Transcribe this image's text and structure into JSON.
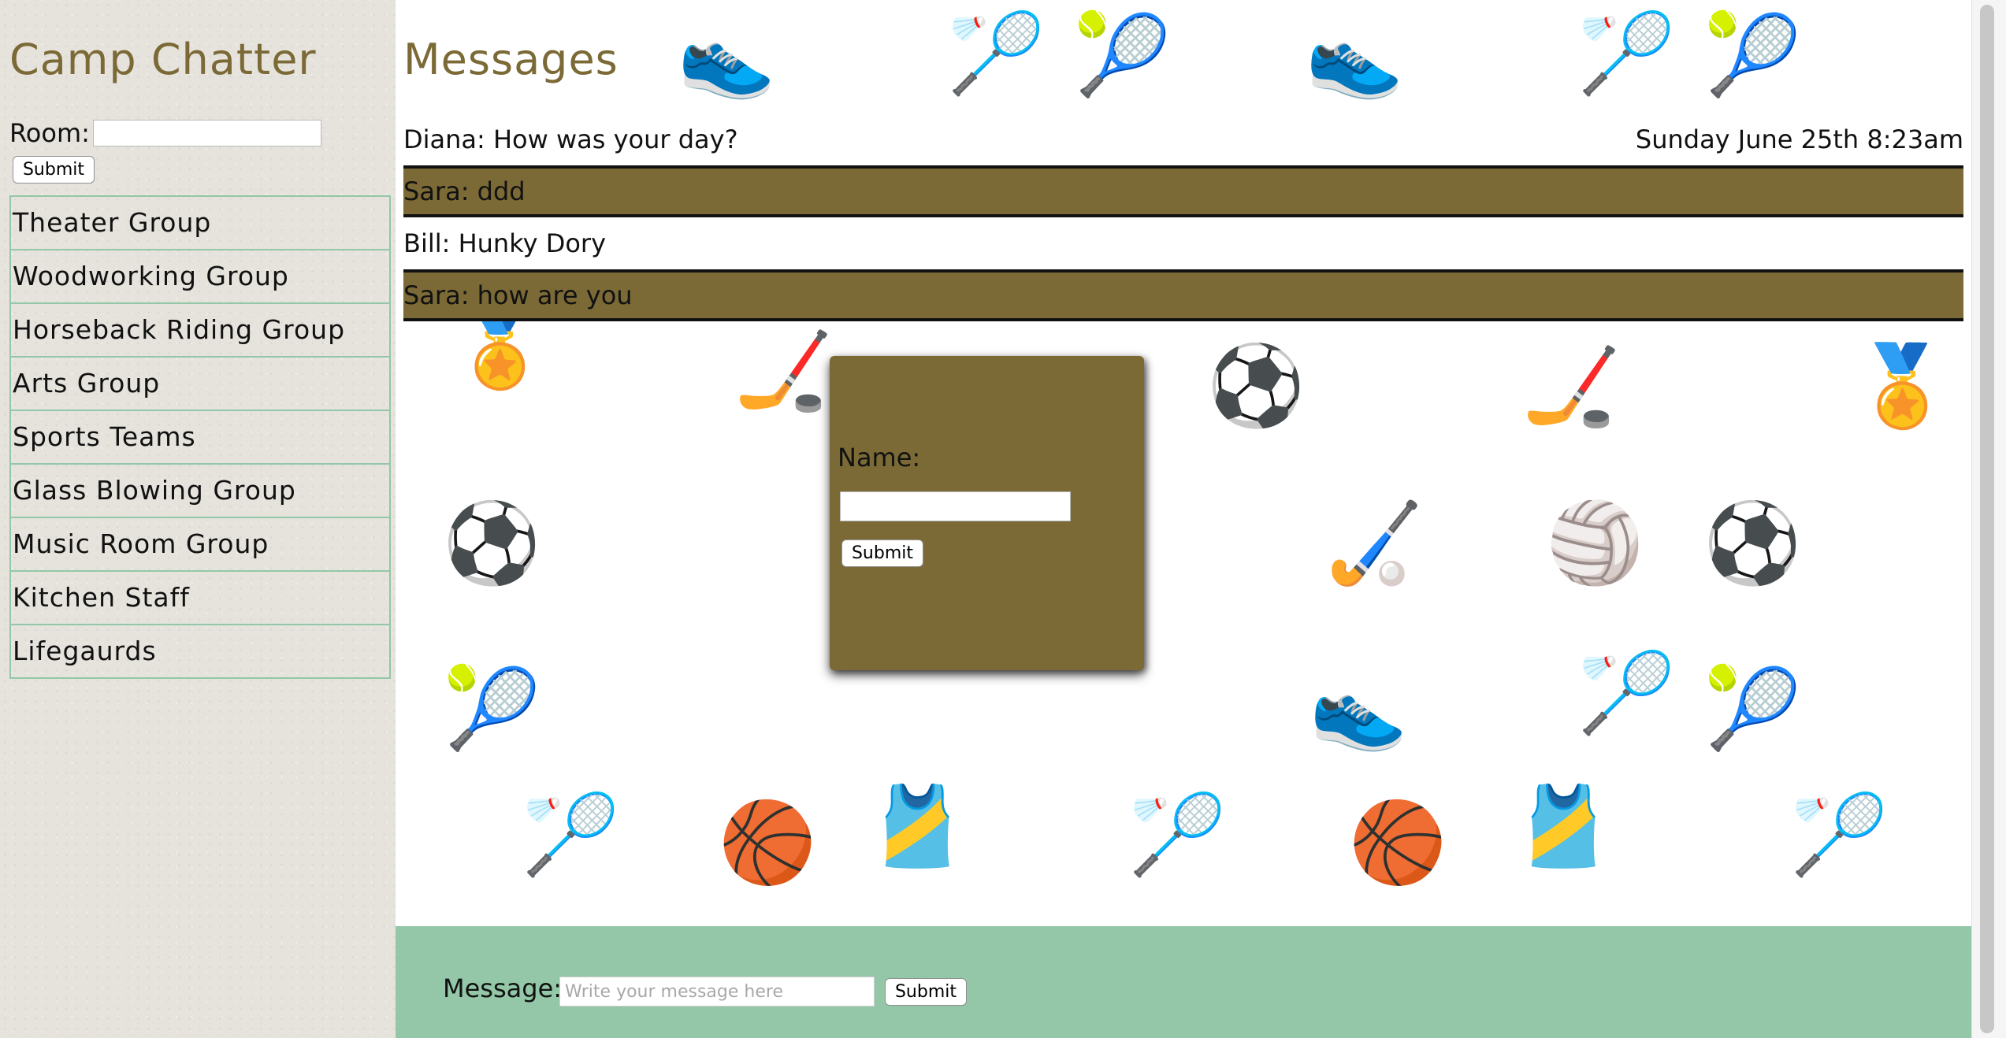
{
  "sidebar": {
    "app_title": "Camp Chatter",
    "room_label": "Room:",
    "room_value": "",
    "room_submit": "Submit",
    "groups": [
      "Theater Group",
      "Woodworking Group",
      "Horseback Riding Group",
      "Arts Group",
      "Sports Teams",
      "Glass Blowing Group",
      "Music Room Group",
      "Kitchen Staff",
      "Lifegaurds"
    ]
  },
  "main": {
    "title": "Messages",
    "messages": [
      {
        "text": "Diana: How was your day?",
        "timestamp": "Sunday June 25th 8:23am"
      },
      {
        "text": "Sara: ddd",
        "timestamp": ""
      },
      {
        "text": "Bill: Hunky Dory",
        "timestamp": ""
      },
      {
        "text": "Sara: how are you",
        "timestamp": ""
      }
    ]
  },
  "name_dialog": {
    "label": "Name:",
    "value": "",
    "submit": "Submit"
  },
  "composer": {
    "label": "Message:",
    "placeholder": "Write your message here",
    "submit": "Submit"
  },
  "colors": {
    "accent_brown": "#7b6a36",
    "accent_green": "#93c7a7",
    "sidebar_bg": "#e6e3dd"
  },
  "background_icons": [
    "shoe-icon",
    "shuttlecock-icon",
    "tennis-ball-icon",
    "medal-icon",
    "hockey-puck-icon",
    "soccer-ball-icon",
    "hockey-sticks-icon",
    "volleyball-icon",
    "basketball-icon",
    "jersey-icon",
    "tennis-racket-icon"
  ]
}
